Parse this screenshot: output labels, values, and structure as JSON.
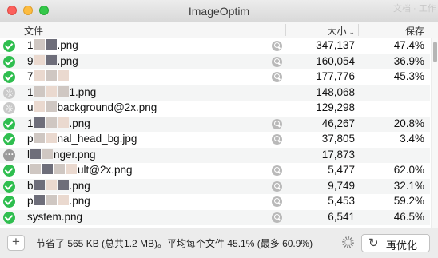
{
  "window": {
    "title": "ImageOptim",
    "background_hint": "文档 · 工作"
  },
  "columns": {
    "file": "文件",
    "size": "大小",
    "size_sort_icon": "chevron-down-icon",
    "saved": "保存"
  },
  "rows": [
    {
      "status": "done",
      "name_prefix": "1",
      "name_suffix": ".png",
      "size": "347,137",
      "saved": "47.4%"
    },
    {
      "status": "done",
      "name_prefix": "9",
      "name_suffix": ".png",
      "size": "160,054",
      "saved": "36.9%"
    },
    {
      "status": "done",
      "name_prefix": "7",
      "name_suffix": "",
      "size": "177,776",
      "saved": "45.3%"
    },
    {
      "status": "working",
      "name_prefix": "1",
      "name_suffix": "1.png",
      "size": "148,068",
      "saved": ""
    },
    {
      "status": "working",
      "name_prefix": "u",
      "name_suffix": "background@2x.png",
      "size": "129,298",
      "saved": ""
    },
    {
      "status": "done",
      "name_prefix": "1",
      "name_suffix": ".png",
      "size": "46,267",
      "saved": "20.8%"
    },
    {
      "status": "done",
      "name_prefix": "p",
      "name_suffix": "nal_head_bg.jpg",
      "size": "37,805",
      "saved": "3.4%"
    },
    {
      "status": "queued",
      "name_prefix": "l",
      "name_suffix": "nger.png",
      "size": "17,873",
      "saved": ""
    },
    {
      "status": "done",
      "name_prefix": "l",
      "name_suffix": "ult@2x.png",
      "size": "5,477",
      "saved": "62.0%"
    },
    {
      "status": "done",
      "name_prefix": "b",
      "name_suffix": ".png",
      "size": "9,749",
      "saved": "32.1%"
    },
    {
      "status": "done",
      "name_prefix": "p",
      "name_suffix": ".png",
      "size": "5,453",
      "saved": "59.2%"
    },
    {
      "status": "done",
      "name_prefix": "",
      "name_suffix": "system.png",
      "size": "6,541",
      "saved": "46.5%"
    }
  ],
  "footer": {
    "add_label": "+",
    "summary": "节省了 565 KB (总共1.2 MB)。平均每个文件 45.1% (最多 60.9%)",
    "reoptimize_icon": "↻",
    "reoptimize_label": "再优化"
  }
}
